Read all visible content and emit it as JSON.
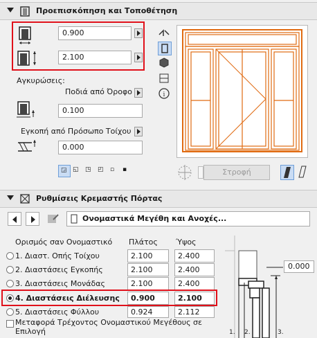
{
  "section1": {
    "title": "Προεπισκόπηση και Τοποθέτηση",
    "width_value": "0.900",
    "height_value": "2.100",
    "anchors_label": "Αγκυρώσεις:",
    "anchor_dropdown": "Ποδιά από Όροφο 0",
    "anchor_value": "0.100",
    "reveal_dropdown": "Εγκοπή από Πρόσωπο Τοίχου",
    "reveal_value": "0.000",
    "rotate_button": "Στροφή"
  },
  "section2": {
    "title": "Ρυθμίσεις Κρεμαστής Πόρτας",
    "nominal_dropdown": "Ονομαστικά Μεγέθη και Ανοχές...",
    "col_title": "Ορισμός σαν Ονομαστικό",
    "col_width": "Πλάτος",
    "col_height": "Ύψος",
    "rows": [
      {
        "label": "1. Διαστ. Οπής Τοίχου",
        "width": "2.100",
        "height": "2.400",
        "selected": false
      },
      {
        "label": "2. Διαστάσεις Εγκοπής",
        "width": "2.100",
        "height": "2.400",
        "selected": false
      },
      {
        "label": "3. Διαστάσεις Μονάδας",
        "width": "2.100",
        "height": "2.400",
        "selected": false
      },
      {
        "label": "4. Διαστάσεις Διέλευσης",
        "width": "0.900",
        "height": "2.100",
        "selected": true
      },
      {
        "label": "5. Διαστάσεις Φύλλου",
        "width": "0.924",
        "height": "2.112",
        "selected": false
      }
    ],
    "transfer_label": "Μεταφορά Τρέχοντος Ονομαστικού Μεγέθους σε Επιλογή",
    "side_value": "0.000",
    "diagram_labels": [
      "1.",
      "2.",
      "3."
    ]
  },
  "colors": {
    "highlight": "#e0101a",
    "door_frame": "#e06a10",
    "accent": "#1e6fd9"
  }
}
